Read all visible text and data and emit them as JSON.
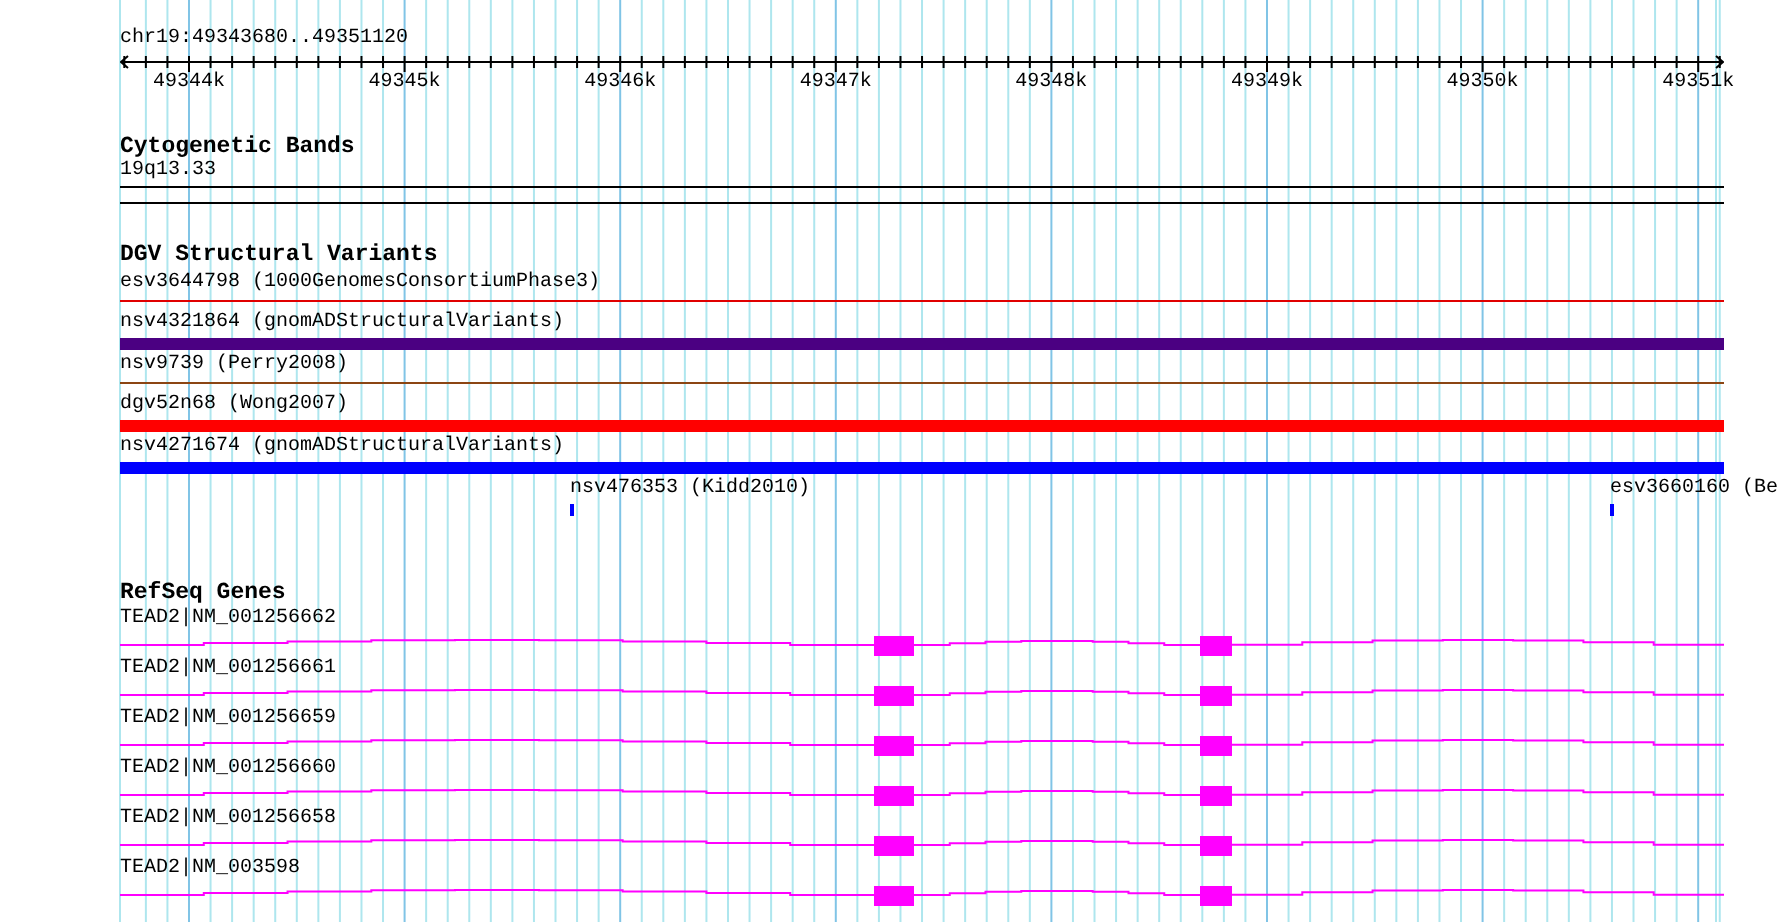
{
  "ruler": {
    "location": "chr19:49343680..49351120",
    "ticks": [
      "49344k",
      "49345k",
      "49346k",
      "49347k",
      "49348k",
      "49349k",
      "49350k",
      "49351k"
    ]
  },
  "tracks": [
    {
      "kind": "bands",
      "title": "Cytogenetic Bands",
      "features": [
        {
          "label": "19q13.33"
        }
      ]
    },
    {
      "kind": "variants",
      "title": "DGV Structural Variants",
      "features": [
        {
          "label": "esv3644798 (1000GenomesConsortiumPhase3)",
          "kind": "line",
          "color": "#e00000"
        },
        {
          "label": "nsv4321864 (gnomADStructuralVariants)",
          "kind": "bar",
          "color": "#4b0082"
        },
        {
          "label": "nsv9739 (Perry2008)",
          "kind": "line",
          "color": "#8b4513"
        },
        {
          "label": "dgv52n68 (Wong2007)",
          "kind": "bar",
          "color": "#ff0000"
        },
        {
          "label": "nsv4271674 (gnomADStructuralVariants)",
          "kind": "bar",
          "color": "#0000ff"
        },
        {
          "label": "nsv476353 (Kidd2010)",
          "kind": "point",
          "color": "#0000ff"
        },
        {
          "label": "esv3660160 (Be",
          "kind": "point",
          "color": "#0000ff"
        }
      ]
    },
    {
      "kind": "genes",
      "title": "RefSeq Genes",
      "features": [
        {
          "label": "TEAD2|NM_001256662"
        },
        {
          "label": "TEAD2|NM_001256661"
        },
        {
          "label": "TEAD2|NM_001256659"
        },
        {
          "label": "TEAD2|NM_001256660"
        },
        {
          "label": "TEAD2|NM_001256658"
        },
        {
          "label": "TEAD2|NM_003598"
        }
      ]
    }
  ]
}
